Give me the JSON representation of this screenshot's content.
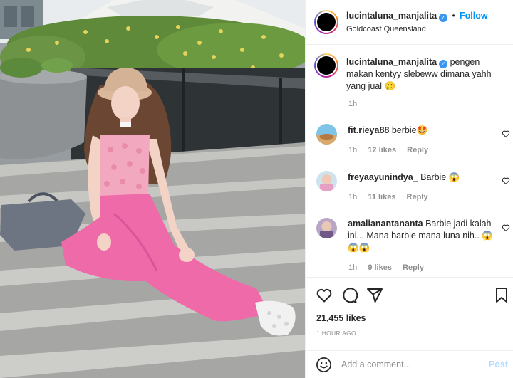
{
  "post": {
    "username": "lucintaluna_manjalita",
    "follow_label": "Follow",
    "location": "Goldcoast Queensland",
    "caption": {
      "line1": "pengen",
      "line2": "makan kentyy slebeww dimana yahh",
      "line3": "yang jual 🥲",
      "time": "1h"
    }
  },
  "comments": [
    {
      "username": "fit.rieya88",
      "text": "berbie🤩",
      "text_line2": "",
      "time": "1h",
      "likes": "12 likes",
      "reply": "Reply"
    },
    {
      "username": "freyaayunindya_",
      "text": "Barbie 😱",
      "text_line2": "",
      "time": "1h",
      "likes": "11 likes",
      "reply": "Reply"
    },
    {
      "username": "amalianantananta",
      "text": "Barbie jadi kalah",
      "text_line2": "ini... Mana barbie mana luna nih.. 😱",
      "text_line3": "😱😱",
      "time": "1h",
      "likes": "9 likes",
      "reply": "Reply"
    }
  ],
  "actions": {
    "like_count": "21,455 likes",
    "time_ago": "1 HOUR AGO"
  },
  "add_comment": {
    "placeholder": "Add a comment...",
    "post_label": "Post"
  },
  "icons": {
    "verified": "verified-badge-icon",
    "heart": "heart-icon",
    "comment": "comment-icon",
    "share": "share-icon",
    "save": "bookmark-icon",
    "emoji": "emoji-icon"
  },
  "colors": {
    "accent": "#0095f6",
    "verified": "#3897f0",
    "post_disabled": "#b3dbff",
    "muted": "#8e8e8e",
    "text": "#262626"
  }
}
